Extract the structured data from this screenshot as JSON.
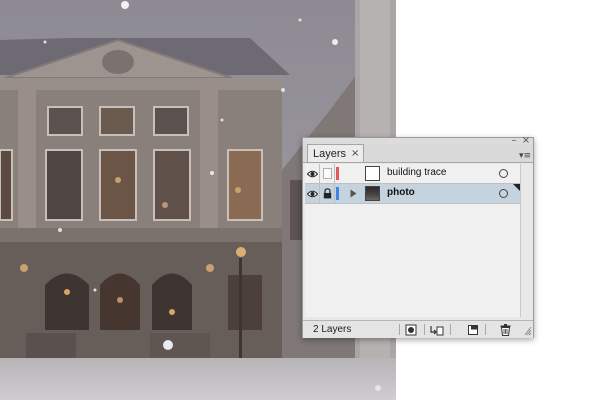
{
  "panel": {
    "tab_label": "Layers",
    "tab_close_glyph": "×",
    "minimize_glyph": "–",
    "close_glyph": "×",
    "menu_glyph": "▾≡"
  },
  "layers": [
    {
      "name": "building trace",
      "visible": true,
      "locked": false,
      "color": "#e05a5a",
      "selected": false,
      "expandable": false
    },
    {
      "name": "photo",
      "visible": true,
      "locked": true,
      "color": "#3f84e0",
      "selected": true,
      "expandable": true
    }
  ],
  "footer": {
    "layer_count": "2 Layers",
    "buttons": [
      "make-clipping-mask-icon",
      "create-sublayer-icon",
      "create-new-layer-icon",
      "delete-layer-icon"
    ]
  },
  "colors": {
    "selected_row": "#c5d3df",
    "trace_layer_color": "#e05a5a",
    "photo_layer_color": "#3f84e0"
  }
}
